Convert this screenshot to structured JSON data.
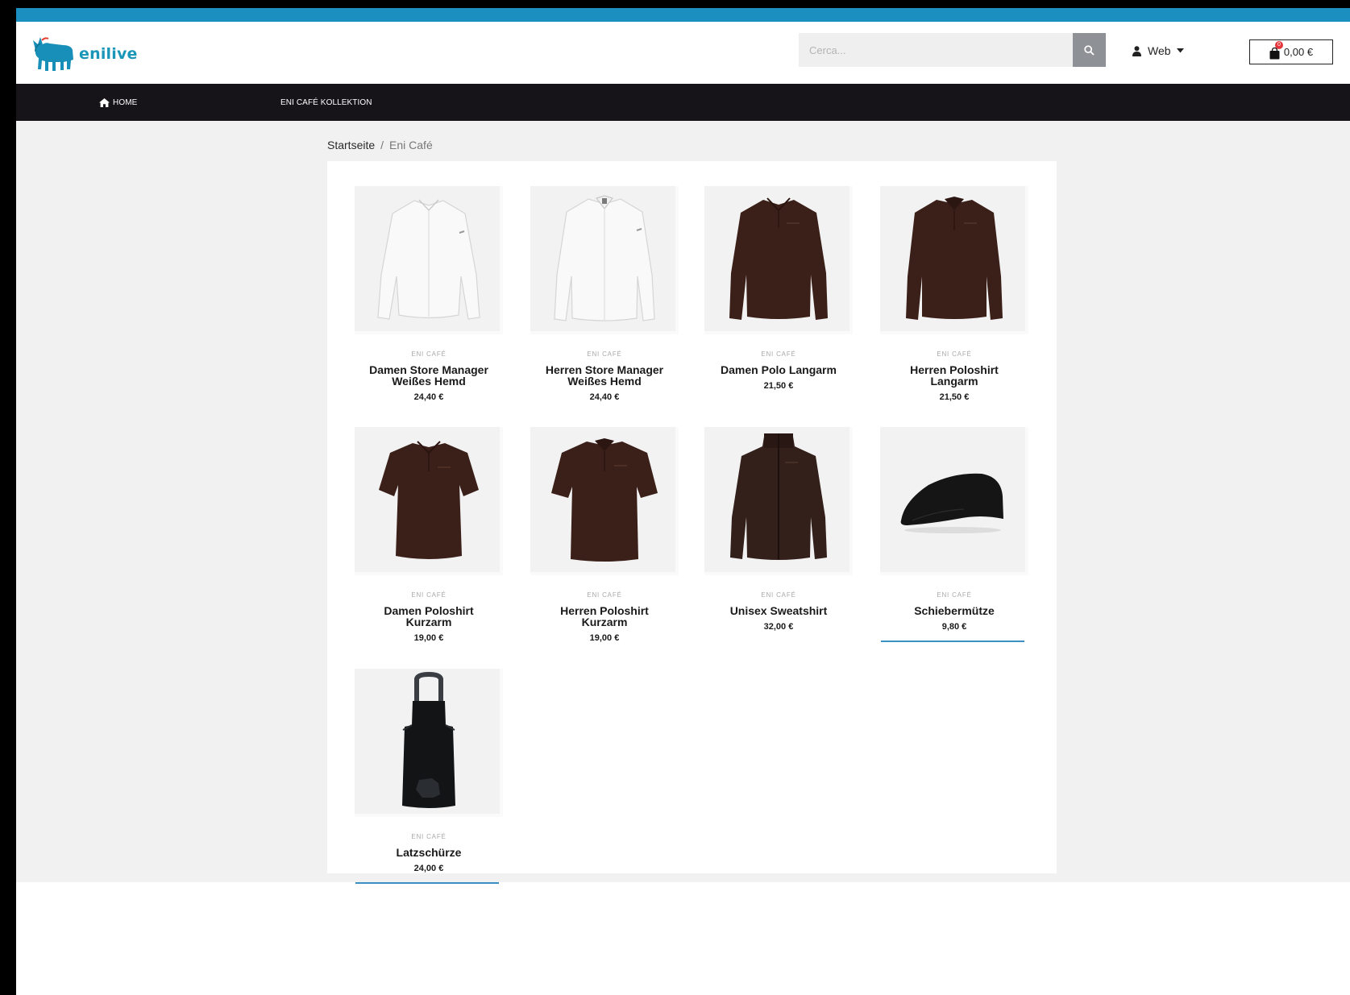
{
  "header": {
    "logo_text": "enilive",
    "search_placeholder": "Cerca...",
    "account_label": "Web",
    "cart_total": "0,00 €",
    "cart_count": "0"
  },
  "nav": {
    "home_label": "HOME",
    "collection_label": "ENI CAFÉ KOLLEKTION"
  },
  "breadcrumb": {
    "home": "Startseite",
    "separator": "/",
    "current": "Eni Café"
  },
  "products": [
    {
      "category": "ENI CAFÉ",
      "name": "Damen Store Manager Weißes Hemd",
      "price": "24,40 €",
      "image": "white-shirt-women",
      "color": "#f7f7f7"
    },
    {
      "category": "ENI CAFÉ",
      "name": "Herren Store Manager Weißes Hemd",
      "price": "24,40 €",
      "image": "white-shirt-men",
      "color": "#f7f7f7"
    },
    {
      "category": "ENI CAFÉ",
      "name": "Damen Polo Langarm",
      "price": "21,50 €",
      "image": "brown-longsleeve-polo-women",
      "color": "#3b2019"
    },
    {
      "category": "ENI CAFÉ",
      "name": "Herren Poloshirt Langarm",
      "price": "21,50 €",
      "image": "brown-longsleeve-polo-men",
      "color": "#3b2019"
    },
    {
      "category": "ENI CAFÉ",
      "name": "Damen Poloshirt Kurzarm",
      "price": "19,00 €",
      "image": "brown-shortsleeve-polo-women",
      "color": "#3b2019"
    },
    {
      "category": "ENI CAFÉ",
      "name": "Herren Poloshirt Kurzarm",
      "price": "19,00 €",
      "image": "brown-shortsleeve-polo-men",
      "color": "#3b2019"
    },
    {
      "category": "ENI CAFÉ",
      "name": "Unisex Sweatshirt",
      "price": "32,00 €",
      "image": "brown-zip-sweatshirt",
      "color": "#33201b"
    },
    {
      "category": "ENI CAFÉ",
      "name": "Schiebermütze",
      "price": "9,80 €",
      "image": "black-flat-cap",
      "color": "#151515"
    },
    {
      "category": "ENI CAFÉ",
      "name": "Latzschürze",
      "price": "24,00 €",
      "image": "black-bib-apron",
      "color": "#121416"
    }
  ],
  "colors": {
    "accent": "#1b8fc0",
    "nav_background": "#161418",
    "content_background": "#f1f1f1",
    "hover_underline": "#3a8fc4",
    "badge": "#e4373e"
  }
}
